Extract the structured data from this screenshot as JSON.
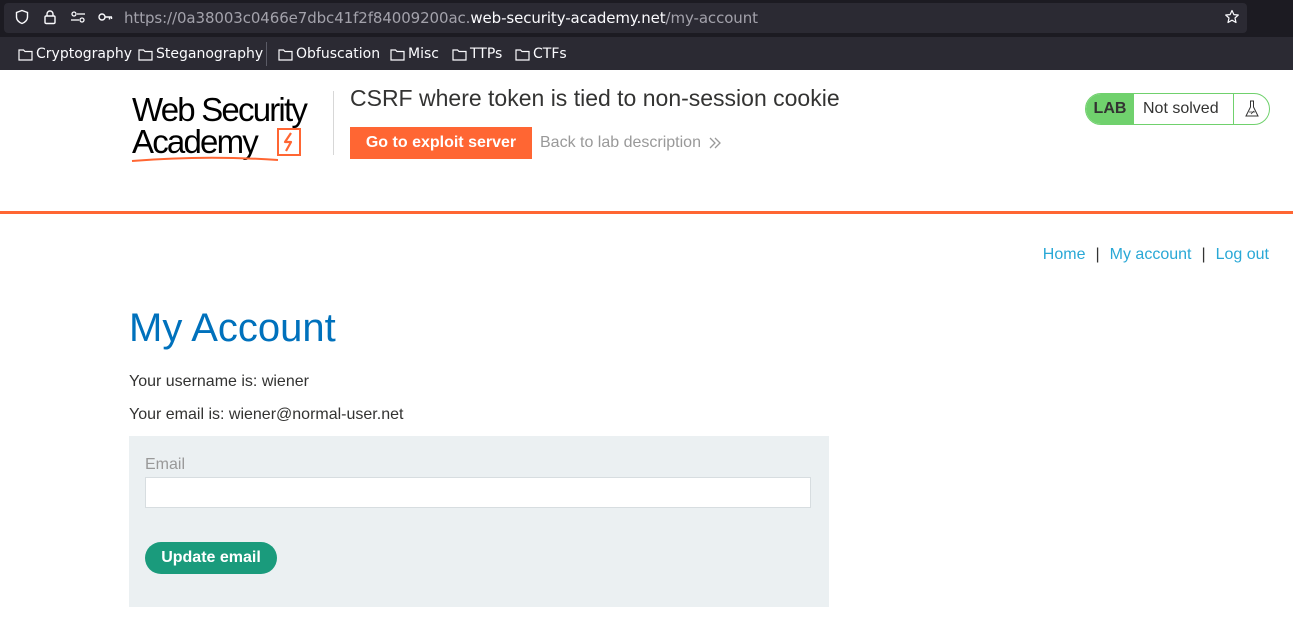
{
  "browser": {
    "url_dim_prefix": "https://0a38003c0466e7dbc41f2f84009200ac.",
    "url_host": "web-security-academy.net",
    "url_path": "/my-account",
    "bookmarks": [
      "Cryptography",
      "Steganography",
      "Obfuscation",
      "Misc",
      "TTPs",
      "CTFs"
    ]
  },
  "header": {
    "logo_line1": "Web Security",
    "logo_line2": "Academy",
    "lab_title": "CSRF where token is tied to non-session cookie",
    "exploit_button": "Go to exploit server",
    "back_link": "Back to lab description",
    "lab_badge": "LAB",
    "lab_status": "Not solved"
  },
  "nav": {
    "home": "Home",
    "separator": "|",
    "my_account": "My account",
    "log_out": "Log out"
  },
  "account": {
    "title": "My Account",
    "username_line": "Your username is: wiener",
    "email_line": "Your email is: wiener@normal-user.net",
    "email_label": "Email",
    "email_value": "",
    "update_button": "Update email"
  },
  "colors": {
    "accent_orange": "#ff6633",
    "title_blue": "#0071bc",
    "link_blue": "#29a8d6",
    "lab_green": "#70d16d",
    "button_teal": "#1a9b7c",
    "panel_bg": "#ebf0f2"
  },
  "icons": {
    "shield": "shield-icon",
    "lock": "lock-icon",
    "permissions": "permissions-icon",
    "key": "key-icon",
    "star": "bookmark-star-icon",
    "folder": "folder-icon",
    "chevrons": "double-chevron-right-icon",
    "flask": "flask-icon"
  }
}
